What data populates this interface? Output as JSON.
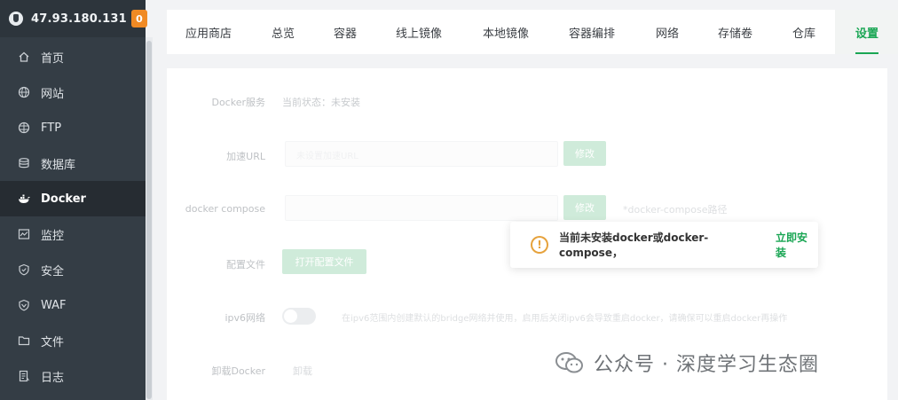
{
  "header": {
    "server_ip": "47.93.180.131",
    "badge_count": "0"
  },
  "sidebar": {
    "items": [
      {
        "label": "首页",
        "icon": "home-icon"
      },
      {
        "label": "网站",
        "icon": "globe-icon"
      },
      {
        "label": "FTP",
        "icon": "ftp-globe-icon"
      },
      {
        "label": "数据库",
        "icon": "database-icon"
      },
      {
        "label": "Docker",
        "icon": "docker-icon",
        "active": true
      },
      {
        "label": "监控",
        "icon": "monitor-icon"
      },
      {
        "label": "安全",
        "icon": "shield-icon"
      },
      {
        "label": "WAF",
        "icon": "waf-shield-icon"
      },
      {
        "label": "文件",
        "icon": "folder-icon"
      },
      {
        "label": "日志",
        "icon": "log-icon"
      }
    ]
  },
  "tabs": [
    "应用商店",
    "总览",
    "容器",
    "线上镜像",
    "本地镜像",
    "容器编排",
    "网络",
    "存储卷",
    "仓库",
    "设置"
  ],
  "active_tab": "设置",
  "settings": {
    "docker_service_label": "Docker服务",
    "docker_service_status": "当前状态：未安装",
    "mirror_url_label": "加速URL",
    "mirror_url_value": "未设置加速URL",
    "modify_button_1": "修改",
    "compose_label": "docker compose",
    "modify_button_2": "修改",
    "compose_hint": "*docker-compose路径",
    "config_label": "配置文件",
    "open_config_button": "打开配置文件",
    "ipv6_label": "ipv6网络",
    "ipv6_hint": "在ipv6范围内创建默认的bridge网络并使用，启用后关闭ipv6会导致重启docker，请确保可以重启docker再操作",
    "uninstall_label": "卸载Docker",
    "uninstall_button": "卸载"
  },
  "toast": {
    "message": "当前未安装docker或docker-compose，",
    "action": "立即安装",
    "icon": "warning-icon"
  },
  "watermark": {
    "text": "公众号 · 深度学习生态圈"
  },
  "colors": {
    "accent": "#1aa654",
    "sidebar": "#343d45",
    "warning": "#e6a23c",
    "badge": "#f08a24"
  }
}
